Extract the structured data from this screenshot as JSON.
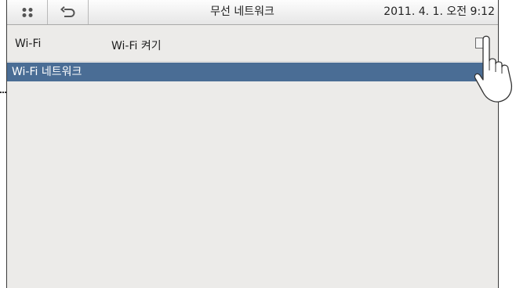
{
  "statusbar": {
    "title": "무선 네트워크",
    "clock": "2011. 4. 1. 오전 9:12"
  },
  "wifi_row": {
    "label": "Wi-Fi",
    "option_label": "Wi-Fi 켜기",
    "checked": false
  },
  "section": {
    "header": "Wi-Fi 네트워크"
  },
  "icons": {
    "menu": "grid-dots-icon",
    "back": "back-arrow-icon",
    "pointer": "hand-pointer-icon"
  },
  "colors": {
    "section_bar": "#4a6d95",
    "screen_bg": "#ecebe9"
  }
}
